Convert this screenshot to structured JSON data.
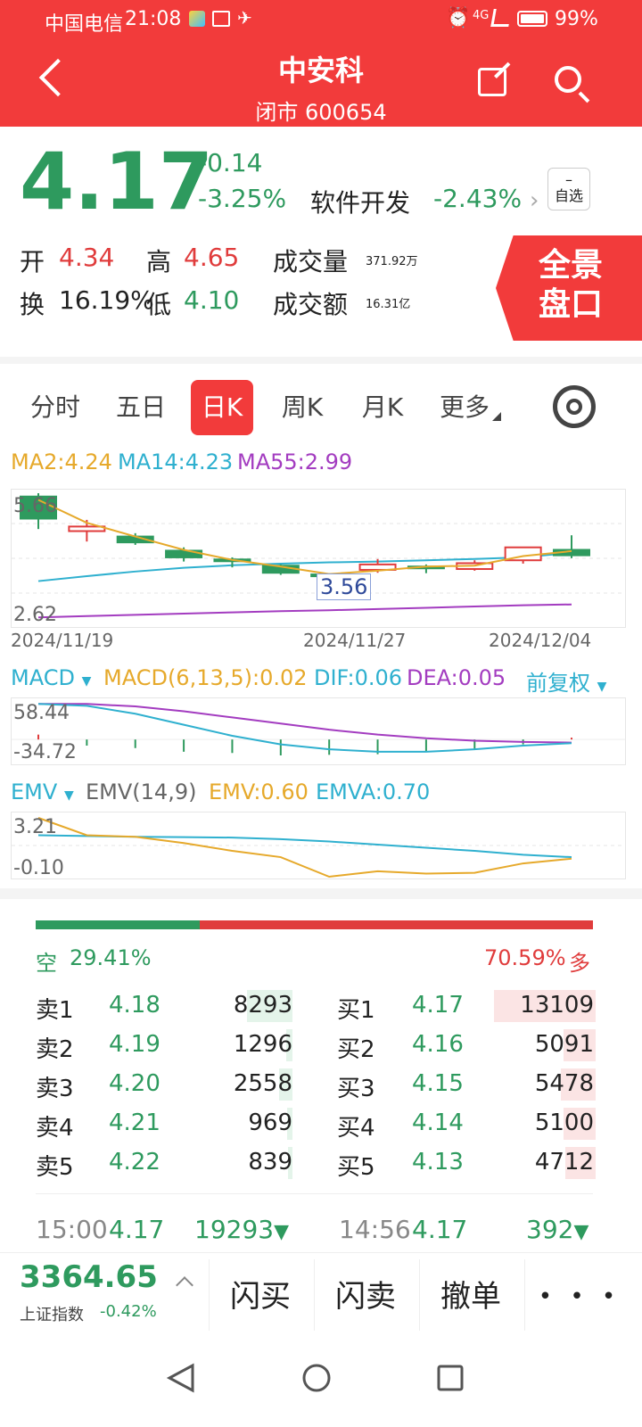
{
  "status_bar": {
    "carrier": "中国电信",
    "time": "21:08",
    "signal": "4G",
    "battery": "99%"
  },
  "header": {
    "back_icon": "chevron-left-icon",
    "stock_name": "中安科",
    "status_code": "闭市 600654",
    "share_icon": "share-icon",
    "search_icon": "search-icon"
  },
  "quote": {
    "price": "4.17",
    "change": "-0.14",
    "change_pct": "-3.25%",
    "sector_name": "软件开发",
    "sector_change": "-2.43%",
    "watch_symbol": "–",
    "watch_label": "自选",
    "open_label": "开",
    "open": "4.34",
    "high_label": "高",
    "high": "4.65",
    "volume_label": "成交量",
    "volume": "371.92万",
    "turnover_label": "换",
    "turnover": "16.19%",
    "low_label": "低",
    "low": "4.10",
    "amount_label": "成交额",
    "amount": "16.31亿",
    "panorama_line1": "全景",
    "panorama_line2": "盘口"
  },
  "tabs": [
    "分时",
    "五日",
    "日K",
    "周K",
    "月K",
    "更多"
  ],
  "active_tab": 2,
  "settings_icon": "gear-icon",
  "ma_legend": {
    "ma2": "MA2:4.24",
    "ma14": "MA14:4.23",
    "ma55": "MA55:2.99"
  },
  "colors": {
    "header_red": "#f23b3b",
    "up_red": "#e03c3c",
    "down_green": "#2e9a5e",
    "ma2": "#e6a92b",
    "ma14": "#2fb0cf",
    "ma55": "#a33cc0"
  },
  "chart_data": [
    {
      "type": "candlestick",
      "name": "kline",
      "y_top_label": "5.66",
      "y_bottom_label": "2.62",
      "ylim": [
        2.62,
        5.66
      ],
      "date_labels": [
        "2024/11/19",
        "2024/11/27",
        "2024/12/04"
      ],
      "annotation": "3.56",
      "candles": [
        {
          "o": 5.58,
          "c": 5.05,
          "h": 5.66,
          "l": 4.8
        },
        {
          "o": 4.75,
          "c": 4.86,
          "h": 5.02,
          "l": 4.5
        },
        {
          "o": 4.62,
          "c": 4.48,
          "h": 4.7,
          "l": 4.42
        },
        {
          "o": 4.28,
          "c": 4.12,
          "h": 4.36,
          "l": 4.02
        },
        {
          "o": 4.07,
          "c": 4.04,
          "h": 4.12,
          "l": 3.88
        },
        {
          "o": 3.92,
          "c": 3.75,
          "h": 3.95,
          "l": 3.7
        },
        {
          "o": 3.71,
          "c": 3.69,
          "h": 3.74,
          "l": 3.56
        },
        {
          "o": 3.82,
          "c": 3.95,
          "h": 4.08,
          "l": 3.75
        },
        {
          "o": 3.9,
          "c": 3.87,
          "h": 3.95,
          "l": 3.74
        },
        {
          "o": 3.84,
          "c": 3.98,
          "h": 4.05,
          "l": 3.8
        },
        {
          "o": 4.05,
          "c": 4.36,
          "h": 4.36,
          "l": 3.97
        },
        {
          "o": 4.3,
          "c": 4.17,
          "h": 4.65,
          "l": 4.1
        }
      ],
      "ma2": [
        5.5,
        4.95,
        4.62,
        4.3,
        4.06,
        3.9,
        3.72,
        3.8,
        3.9,
        3.92,
        4.15,
        4.27
      ],
      "ma14": [
        3.55,
        3.67,
        3.78,
        3.87,
        3.93,
        3.97,
        4.0,
        4.02,
        4.05,
        4.08,
        4.12,
        4.23
      ],
      "ma55": [
        2.68,
        2.71,
        2.74,
        2.77,
        2.8,
        2.83,
        2.85,
        2.88,
        2.91,
        2.94,
        2.97,
        2.99
      ]
    },
    {
      "type": "macd",
      "name": "MACD",
      "y_top_label": "58.44",
      "y_bottom_label": "-34.72",
      "ylim": [
        -34.72,
        58.44
      ],
      "histogram": [
        8,
        -10,
        -14,
        -20,
        -22,
        -26,
        -25,
        -24,
        -20,
        -16,
        -8,
        3
      ],
      "dif": [
        58,
        55,
        42,
        24,
        6,
        -8,
        -16,
        -20,
        -20,
        -16,
        -10,
        -6
      ],
      "dea": [
        58,
        58,
        54,
        46,
        36,
        26,
        16,
        8,
        2,
        -2,
        -4,
        -5
      ]
    },
    {
      "type": "emv",
      "name": "EMV",
      "y_top_label": "3.21",
      "y_bottom_label": "-0.10",
      "ylim": [
        -0.55,
        3.21
      ],
      "emv": [
        3.21,
        2.1,
        2.0,
        1.6,
        1.1,
        0.7,
        -0.55,
        -0.2,
        -0.35,
        -0.3,
        0.3,
        0.6
      ],
      "emva": [
        2.1,
        2.05,
        2.0,
        1.98,
        1.95,
        1.85,
        1.7,
        1.5,
        1.3,
        1.1,
        0.85,
        0.7
      ]
    }
  ],
  "macd_legend": {
    "name": "MACD",
    "params": "MACD(6,13,5):0.02",
    "dif": "DIF:0.06",
    "dea": "DEA:0.05",
    "adjust": "前复权"
  },
  "emv_legend": {
    "name": "EMV",
    "params": "EMV(14,9)",
    "emv": "EMV:0.60",
    "emva": "EMVA:0.70"
  },
  "orderbook": {
    "short_label": "空",
    "short_pct": "29.41%",
    "long_label": "多",
    "long_pct": "70.59%",
    "short_ratio": 0.2941,
    "sells": [
      {
        "label": "卖1",
        "price": "4.18",
        "vol": "8293",
        "bar": 0.55
      },
      {
        "label": "卖2",
        "price": "4.19",
        "vol": "1296",
        "bar": 0.08
      },
      {
        "label": "卖3",
        "price": "4.20",
        "vol": "2558",
        "bar": 0.16
      },
      {
        "label": "卖4",
        "price": "4.21",
        "vol": "969",
        "bar": 0.06
      },
      {
        "label": "卖5",
        "price": "4.22",
        "vol": "839",
        "bar": 0.05
      }
    ],
    "buys": [
      {
        "label": "买1",
        "price": "4.17",
        "vol": "13109",
        "bar": 1.0
      },
      {
        "label": "买2",
        "price": "4.16",
        "vol": "5091",
        "bar": 0.32
      },
      {
        "label": "买3",
        "price": "4.15",
        "vol": "5478",
        "bar": 0.34
      },
      {
        "label": "买4",
        "price": "4.14",
        "vol": "5100",
        "bar": 0.32
      },
      {
        "label": "买5",
        "price": "4.13",
        "vol": "4712",
        "bar": 0.3
      }
    ]
  },
  "ticks": [
    {
      "time": "15:00",
      "price": "4.17",
      "vol": "19293"
    },
    {
      "time": "14:56",
      "price": "4.17",
      "vol": "392"
    }
  ],
  "bottom_bar": {
    "index_value": "3364.65",
    "index_name": "上证指数",
    "index_change": "-0.42%",
    "flash_buy": "闪买",
    "flash_sell": "闪卖",
    "cancel": "撤单",
    "more": "• • •"
  },
  "nav": {
    "back": "triangle-back-icon",
    "home": "circle-home-icon",
    "recent": "square-recent-icon"
  }
}
